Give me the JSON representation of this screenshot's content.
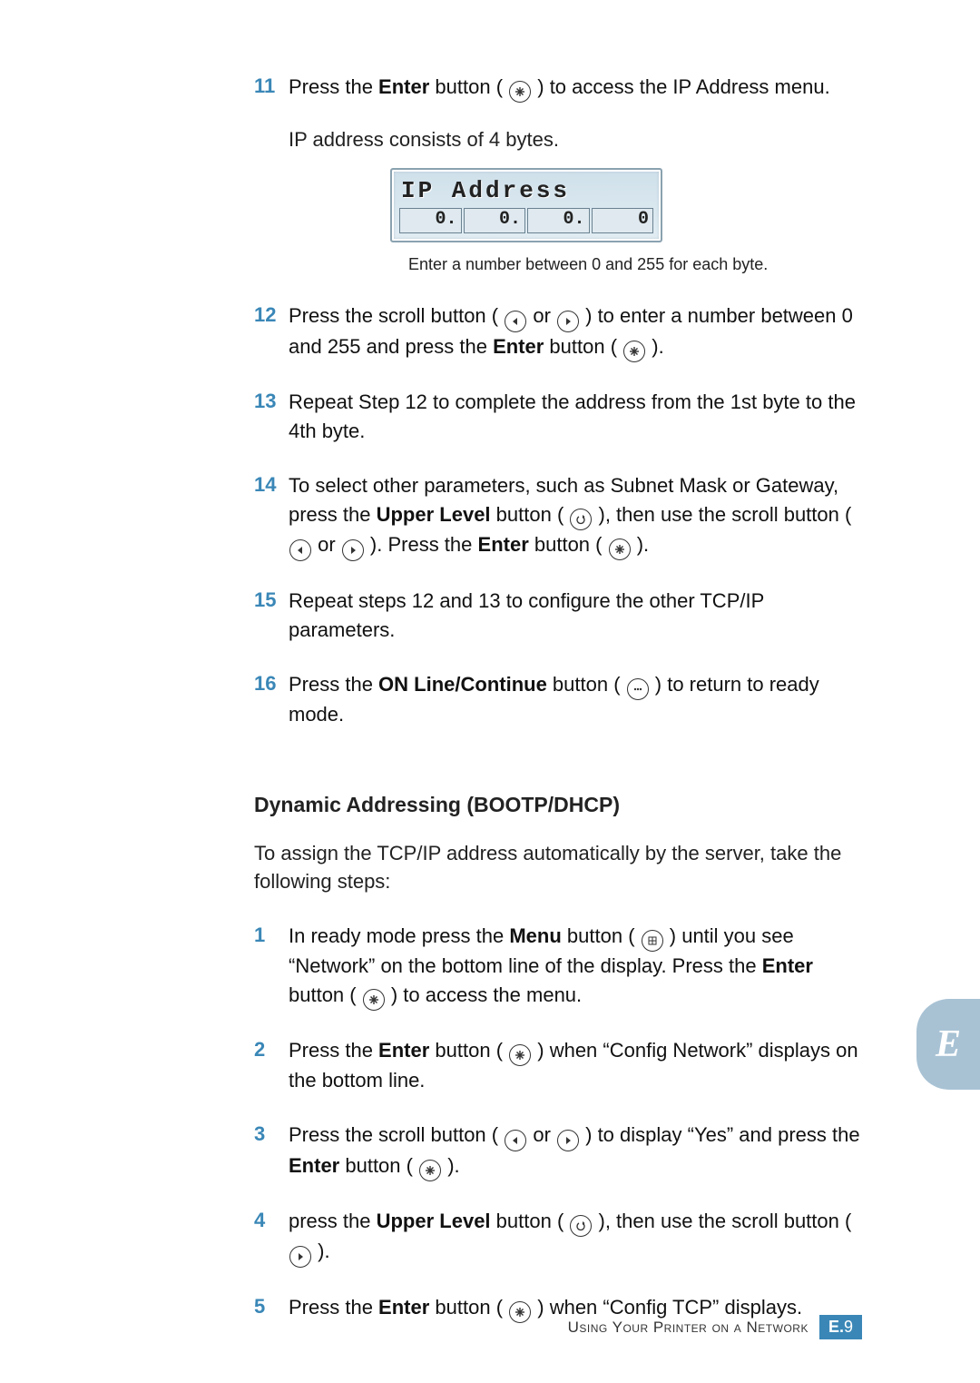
{
  "icons": {
    "enter": "asterisk-icon",
    "scroll_left": "triangle-left-icon",
    "scroll_right": "triangle-right-icon",
    "upper_level": "return-arrow-icon",
    "online": "dots-icon",
    "menu": "grid-icon"
  },
  "steps_top": [
    {
      "num": "11",
      "parts": [
        "Press the ",
        "Enter",
        " button ( ",
        {
          "icon": "enter"
        },
        " ) to access the IP Address menu."
      ],
      "followup": "IP address consists of 4 bytes."
    },
    {
      "num": "12",
      "parts": [
        "Press the scroll button ( ",
        {
          "icon": "scroll_left"
        },
        " or ",
        {
          "icon": "scroll_right"
        },
        " ) to enter a number between 0 and 255 and press the ",
        "Enter",
        " button ( ",
        {
          "icon": "enter"
        },
        " )."
      ]
    },
    {
      "num": "13",
      "parts": [
        "Repeat Step 12 to complete the address from the 1st byte to the 4th byte."
      ]
    },
    {
      "num": "14",
      "parts": [
        "To select other parameters, such as Subnet Mask or Gateway, press the ",
        "Upper Level",
        " button ( ",
        {
          "icon": "upper_level"
        },
        " ), then use the scroll button ( ",
        {
          "icon": "scroll_left"
        },
        " or ",
        {
          "icon": "scroll_right"
        },
        " ). Press the ",
        "Enter",
        " button ( ",
        {
          "icon": "enter"
        },
        " )."
      ]
    },
    {
      "num": "15",
      "parts": [
        "Repeat steps  12 and 13 to configure the other TCP/IP parameters."
      ]
    },
    {
      "num": "16",
      "parts": [
        "Press the ",
        "ON Line/Continue",
        " button ( ",
        {
          "icon": "online"
        },
        " ) to return to ready mode."
      ]
    }
  ],
  "lcd": {
    "line1": "IP Address",
    "segments": [
      "0.",
      "0.",
      "0.",
      "0"
    ],
    "caption": "Enter a number between 0 and 255 for each byte."
  },
  "section": {
    "title": "Dynamic Addressing (BOOTP/DHCP)",
    "intro": "To assign the TCP/IP address automatically by the server, take the following steps:",
    "steps": [
      {
        "num": "1",
        "parts": [
          "In ready mode press the ",
          "Menu",
          " button ( ",
          {
            "icon": "menu"
          },
          " ) until you see “Network” on the bottom line of the display. Press the ",
          "Enter",
          " button ( ",
          {
            "icon": "enter"
          },
          " ) to access the menu."
        ]
      },
      {
        "num": "2",
        "parts": [
          "Press the ",
          "Enter",
          " button ( ",
          {
            "icon": "enter"
          },
          " ) when “Config Network” displays on the bottom line."
        ]
      },
      {
        "num": "3",
        "parts": [
          "Press the scroll button ( ",
          {
            "icon": "scroll_left"
          },
          " or ",
          {
            "icon": "scroll_right"
          },
          " ) to display “Yes” and press the ",
          "Enter",
          " button ( ",
          {
            "icon": "enter"
          },
          " )."
        ]
      },
      {
        "num": "4",
        "parts": [
          "press the ",
          "Upper Level",
          " button ( ",
          {
            "icon": "upper_level"
          },
          " ), then use the scroll button ( ",
          {
            "icon": "scroll_right"
          },
          " )."
        ]
      },
      {
        "num": "5",
        "parts": [
          "Press the ",
          "Enter",
          " button ( ",
          {
            "icon": "enter"
          },
          " ) when “Config TCP” displays."
        ]
      }
    ]
  },
  "chapter_tab": "E",
  "footer": {
    "text": "Using Your Printer on a Network",
    "page_prefix": "E.",
    "page_num": "9"
  }
}
